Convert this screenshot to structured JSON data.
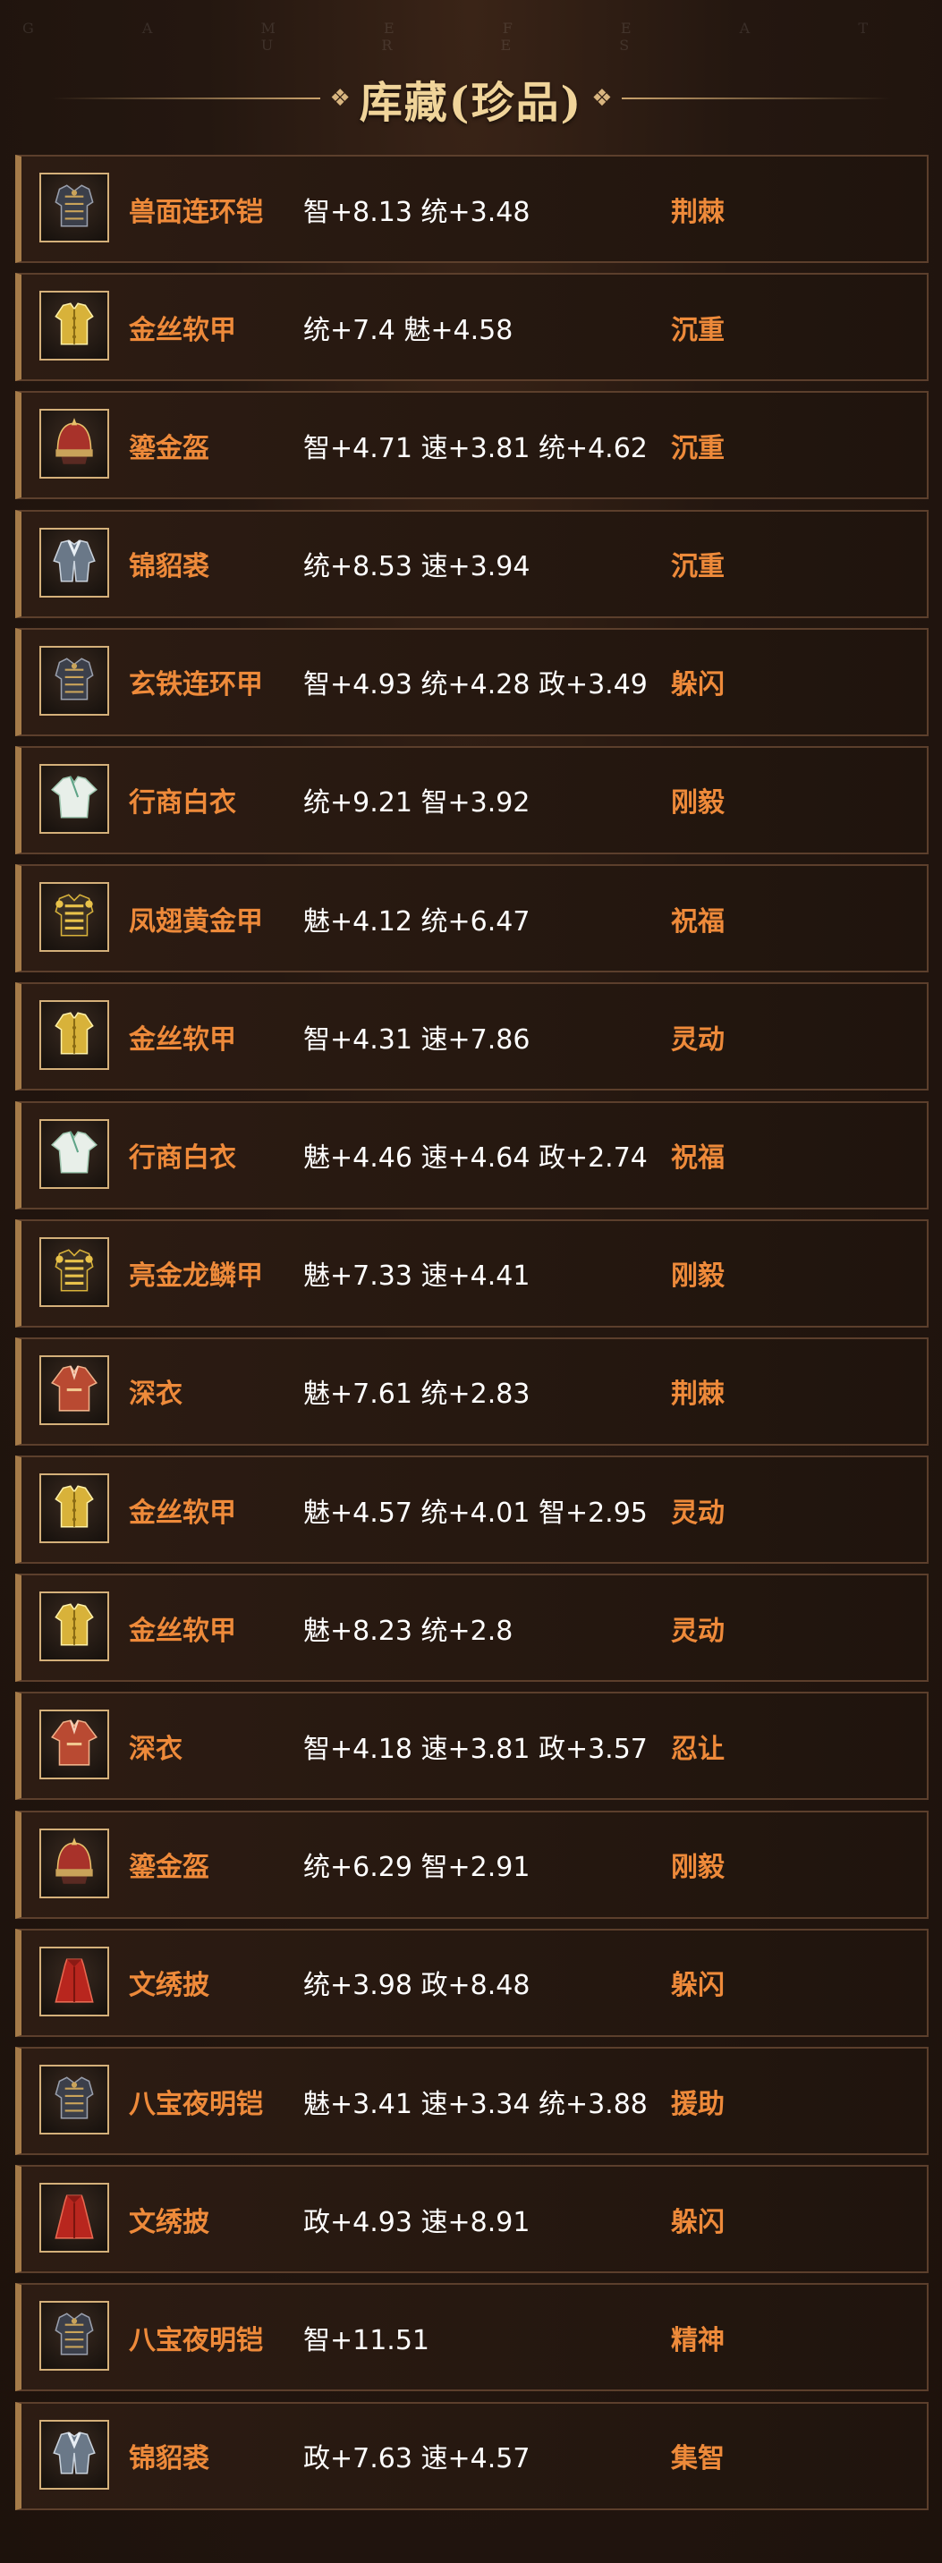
{
  "header": {
    "watermark": "G A M E   F E A T U R E S",
    "ornament_left": "❖",
    "ornament_right": "❖",
    "title": "库藏(珍品)"
  },
  "colors": {
    "name": "#ee8a3a",
    "trait": "#ee8a3a",
    "stats": "#ffffff",
    "frame": "#d4b07a"
  },
  "items": [
    {
      "name": "兽面连环铠",
      "stats": "智+8.13 统+3.48",
      "trait": "荆棘",
      "icon": "dark-armor-icon"
    },
    {
      "name": "金丝软甲",
      "stats": "统+7.4 魅+4.58",
      "trait": "沉重",
      "icon": "gold-vest-icon"
    },
    {
      "name": "鎏金盔",
      "stats": "智+4.71 速+3.81 统+4.62",
      "trait": "沉重",
      "icon": "helmet-icon"
    },
    {
      "name": "锦貂裘",
      "stats": "统+8.53 速+3.94",
      "trait": "沉重",
      "icon": "fur-coat-icon"
    },
    {
      "name": "玄铁连环甲",
      "stats": "智+4.93 统+4.28 政+3.49",
      "trait": "躲闪",
      "icon": "dark-armor-icon"
    },
    {
      "name": "行商白衣",
      "stats": "统+9.21 智+3.92",
      "trait": "刚毅",
      "icon": "white-robe-icon"
    },
    {
      "name": "凤翅黄金甲",
      "stats": "魅+4.12 统+6.47",
      "trait": "祝福",
      "icon": "gold-armor-icon"
    },
    {
      "name": "金丝软甲",
      "stats": "智+4.31 速+7.86",
      "trait": "灵动",
      "icon": "gold-vest-icon"
    },
    {
      "name": "行商白衣",
      "stats": "魅+4.46 速+4.64 政+2.74",
      "trait": "祝福",
      "icon": "white-robe-icon"
    },
    {
      "name": "亮金龙鳞甲",
      "stats": "魅+7.33 速+4.41",
      "trait": "刚毅",
      "icon": "gold-armor-icon"
    },
    {
      "name": "深衣",
      "stats": "魅+7.61 统+2.83",
      "trait": "荆棘",
      "icon": "red-robe-icon"
    },
    {
      "name": "金丝软甲",
      "stats": "魅+4.57 统+4.01 智+2.95",
      "trait": "灵动",
      "icon": "gold-vest-icon"
    },
    {
      "name": "金丝软甲",
      "stats": "魅+8.23 统+2.8",
      "trait": "灵动",
      "icon": "gold-vest-icon"
    },
    {
      "name": "深衣",
      "stats": "智+4.18 速+3.81 政+3.57",
      "trait": "忍让",
      "icon": "red-robe-icon"
    },
    {
      "name": "鎏金盔",
      "stats": "统+6.29 智+2.91",
      "trait": "刚毅",
      "icon": "helmet-icon"
    },
    {
      "name": "文绣披",
      "stats": "统+3.98 政+8.48",
      "trait": "躲闪",
      "icon": "red-cape-icon"
    },
    {
      "name": "八宝夜明铠",
      "stats": "魅+3.41 速+3.34 统+3.88",
      "trait": "援助",
      "icon": "dark-armor-icon"
    },
    {
      "name": "文绣披",
      "stats": "政+4.93 速+8.91",
      "trait": "躲闪",
      "icon": "red-cape-icon"
    },
    {
      "name": "八宝夜明铠",
      "stats": "智+11.51",
      "trait": "精神",
      "icon": "dark-armor-icon"
    },
    {
      "name": "锦貂裘",
      "stats": "政+7.63 速+4.57",
      "trait": "集智",
      "icon": "fur-coat-icon"
    }
  ]
}
